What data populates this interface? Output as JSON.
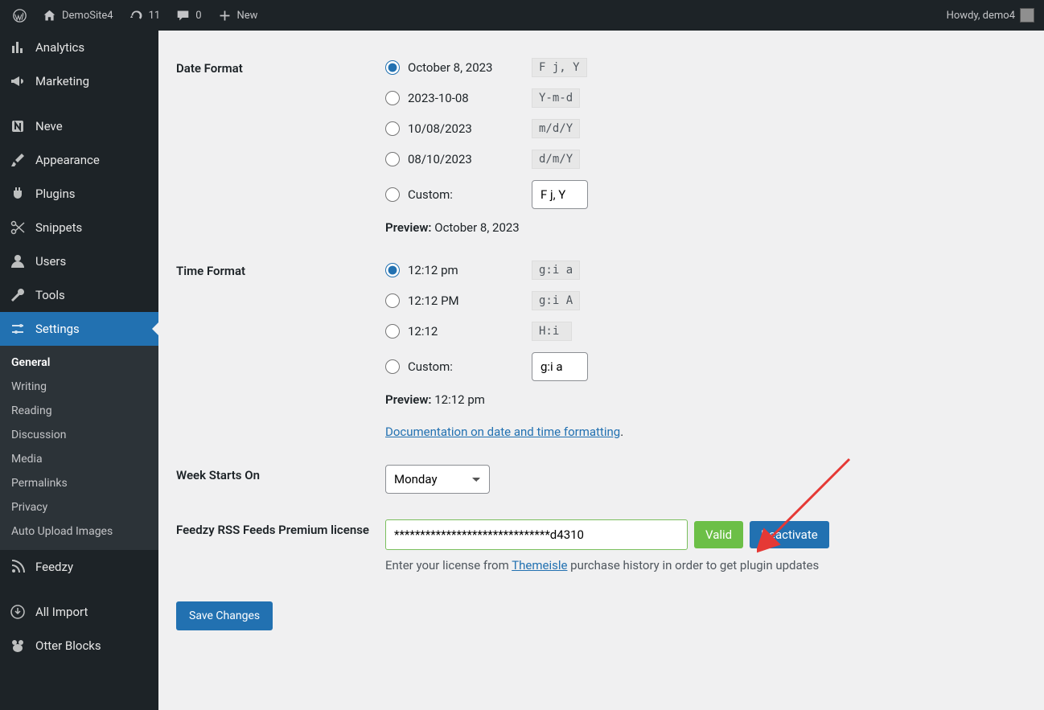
{
  "adminbar": {
    "site_name": "DemoSite4",
    "updates_count": "11",
    "comments_count": "0",
    "new_label": "New",
    "howdy": "Howdy, demo4"
  },
  "sidebar": {
    "items": [
      {
        "label": "Analytics"
      },
      {
        "label": "Marketing"
      },
      {
        "label": "Neve"
      },
      {
        "label": "Appearance"
      },
      {
        "label": "Plugins"
      },
      {
        "label": "Snippets"
      },
      {
        "label": "Users"
      },
      {
        "label": "Tools"
      },
      {
        "label": "Settings"
      },
      {
        "label": "Feedzy"
      },
      {
        "label": "All Import"
      },
      {
        "label": "Otter Blocks"
      }
    ],
    "submenu": [
      {
        "label": "General"
      },
      {
        "label": "Writing"
      },
      {
        "label": "Reading"
      },
      {
        "label": "Discussion"
      },
      {
        "label": "Media"
      },
      {
        "label": "Permalinks"
      },
      {
        "label": "Privacy"
      },
      {
        "label": "Auto Upload Images"
      }
    ]
  },
  "sections": {
    "date_format": {
      "heading": "Date Format",
      "options": [
        {
          "label": "October 8, 2023",
          "code": "F j, Y"
        },
        {
          "label": "2023-10-08",
          "code": "Y-m-d"
        },
        {
          "label": "10/08/2023",
          "code": "m/d/Y"
        },
        {
          "label": "08/10/2023",
          "code": "d/m/Y"
        }
      ],
      "custom_label": "Custom:",
      "custom_value": "F j, Y",
      "preview_label": "Preview:",
      "preview_value": "October 8, 2023"
    },
    "time_format": {
      "heading": "Time Format",
      "options": [
        {
          "label": "12:12 pm",
          "code": "g:i a"
        },
        {
          "label": "12:12 PM",
          "code": "g:i A"
        },
        {
          "label": "12:12",
          "code": "H:i"
        }
      ],
      "custom_label": "Custom:",
      "custom_value": "g:i a",
      "preview_label": "Preview:",
      "preview_value": "12:12 pm",
      "doc_link": "Documentation on date and time formatting"
    },
    "week_starts": {
      "heading": "Week Starts On",
      "value": "Monday"
    },
    "license": {
      "heading": "Feedzy RSS Feeds Premium license",
      "value": "******************************d4310",
      "valid_label": "Valid",
      "deactivate_label": "Deactivate",
      "note_before": "Enter your license from ",
      "note_link": "Themeisle",
      "note_after": " purchase history in order to get plugin updates"
    },
    "save_button": "Save Changes"
  }
}
